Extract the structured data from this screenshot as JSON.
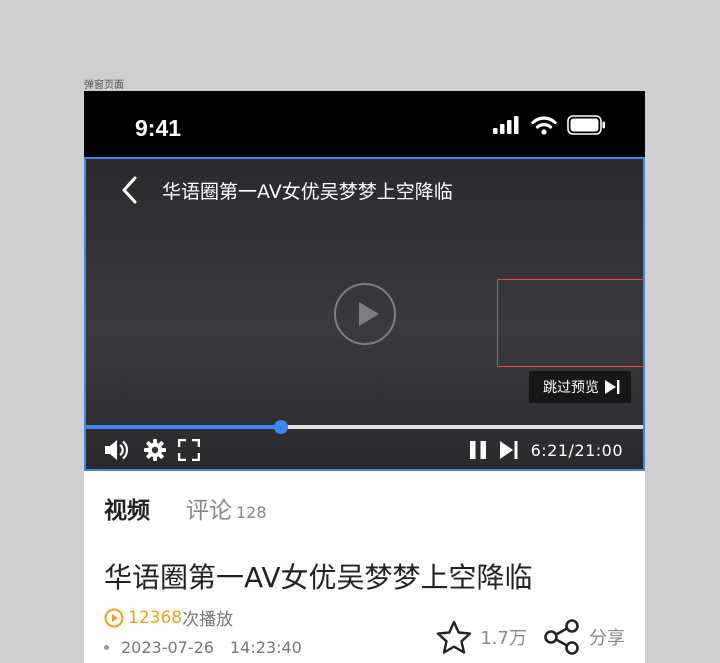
{
  "frame_label": "弹窗页面",
  "status_bar": {
    "time": "9:41"
  },
  "player": {
    "title": "华语圈第一AV女优吴梦梦上空降临",
    "skip_label": "跳过预览",
    "progress_fraction": 0.35,
    "time_current": "6:21",
    "time_separator": "/",
    "time_total": "21:00",
    "accent_color": "#3e86f0"
  },
  "tabs": [
    {
      "label": "视频",
      "active": true
    },
    {
      "label": "评论",
      "count": "128",
      "active": false
    }
  ],
  "video": {
    "title": "华语圈第一AV女优吴梦梦上空降临",
    "play_count": "12368",
    "play_suffix": "次播放",
    "date": "2023-07-26",
    "time": "14:23:40",
    "favorite_count": "1.7万",
    "share_label": "分享",
    "play_color": "#f0a11b"
  },
  "icons": [
    "back-icon",
    "volume-icon",
    "settings-icon",
    "fullscreen-icon",
    "pause-icon",
    "next-icon",
    "play-circle-icon",
    "star-icon",
    "share-icon",
    "signal-icon",
    "wifi-icon",
    "battery-icon",
    "skip-icon"
  ]
}
